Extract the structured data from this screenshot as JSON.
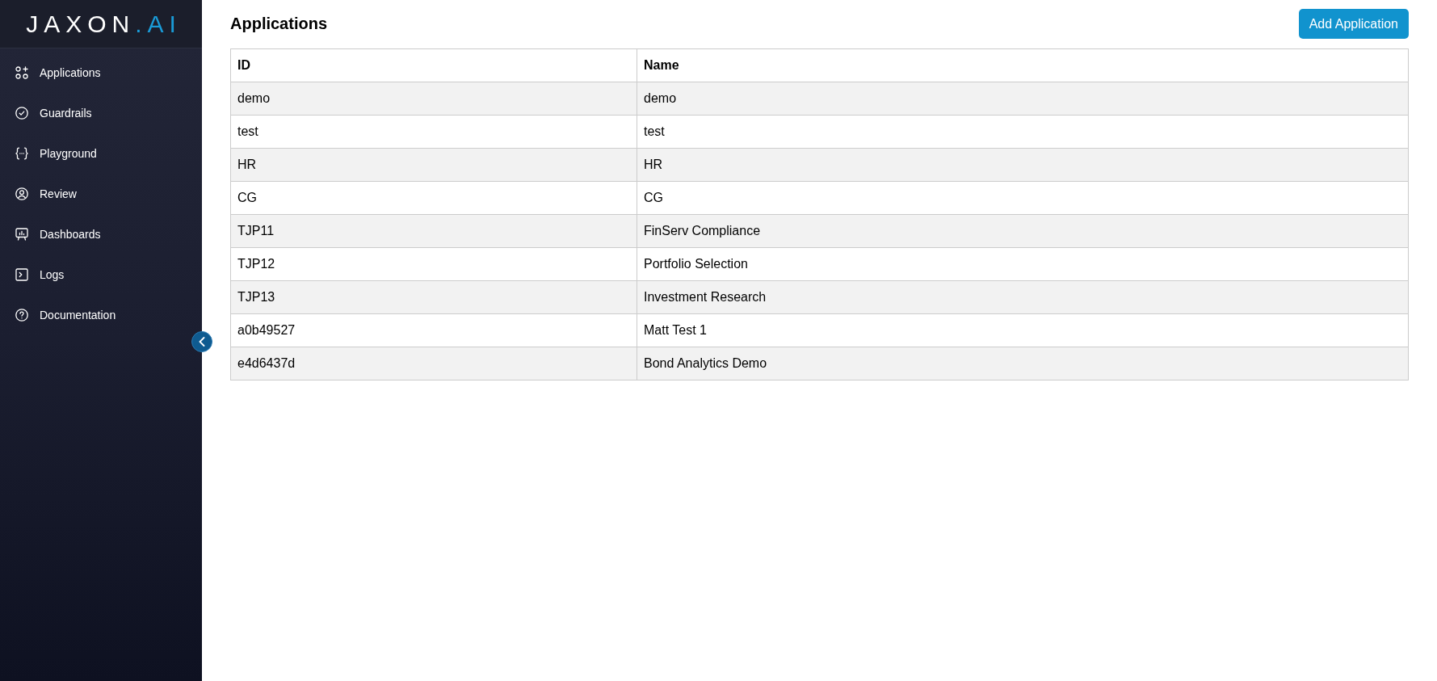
{
  "sidebar": {
    "logo": {
      "text": "JAXON",
      "accent": ".AI"
    },
    "items": [
      {
        "label": "Applications"
      },
      {
        "label": "Guardrails"
      },
      {
        "label": "Playground"
      },
      {
        "label": "Review"
      },
      {
        "label": "Dashboards"
      },
      {
        "label": "Logs"
      },
      {
        "label": "Documentation"
      }
    ]
  },
  "page": {
    "title": "Applications",
    "add_button": "Add Application"
  },
  "table": {
    "columns": [
      "ID",
      "Name"
    ],
    "rows": [
      [
        "demo",
        "demo"
      ],
      [
        "test",
        "test"
      ],
      [
        "HR",
        "HR"
      ],
      [
        "CG",
        "CG"
      ],
      [
        "TJP11",
        "FinServ Compliance"
      ],
      [
        "TJP12",
        "Portfolio Selection"
      ],
      [
        "TJP13",
        "Investment Research"
      ],
      [
        "a0b49527",
        "Matt Test 1"
      ],
      [
        "e4d6437d",
        "Bond Analytics Demo"
      ]
    ]
  }
}
